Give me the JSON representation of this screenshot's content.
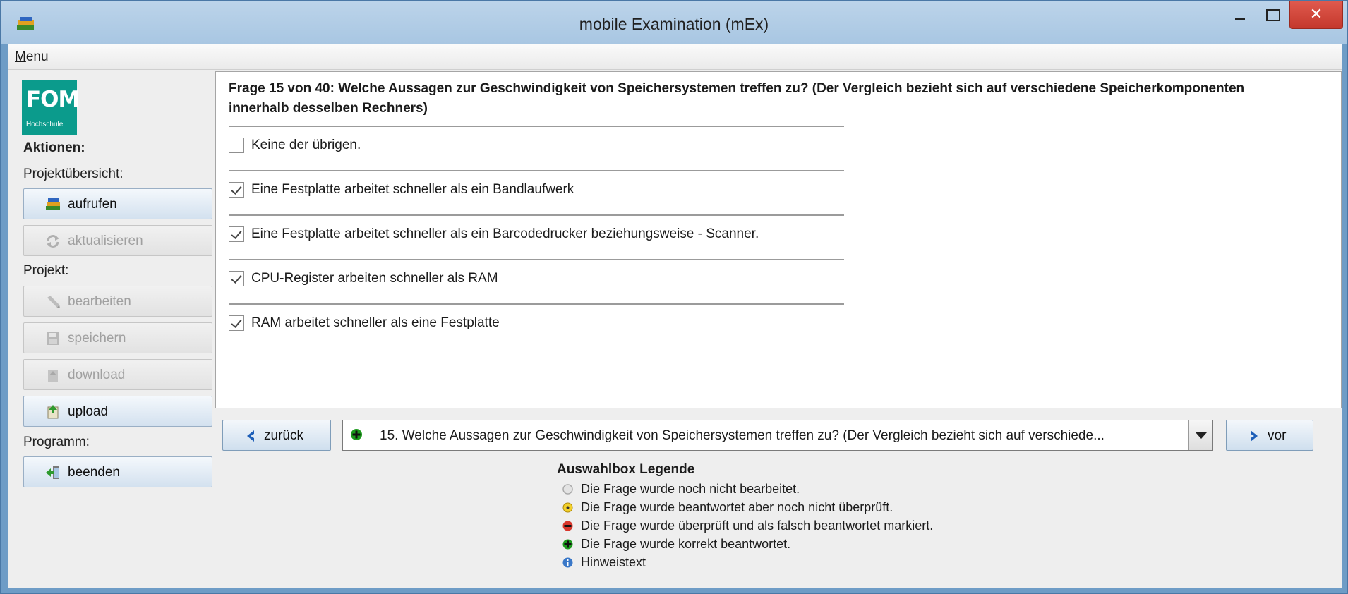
{
  "window": {
    "title": "mobile Examination (mEx)",
    "close_label": "✕"
  },
  "menu": {
    "label_mnemonic": "M",
    "label_rest": "enu"
  },
  "logo": {
    "main": "FOM",
    "sub": "Hochschule"
  },
  "sidebar": {
    "actions_heading": "Aktionen:",
    "overview_label": "Projektübersicht:",
    "btn_open": "aufrufen",
    "btn_refresh": "aktualisieren",
    "project_label": "Projekt:",
    "btn_edit": "bearbeiten",
    "btn_save": "speichern",
    "btn_download": "download",
    "btn_upload": "upload",
    "program_label": "Programm:",
    "btn_exit": "beenden"
  },
  "question": {
    "title": "Frage 15 von 40: Welche Aussagen zur Geschwindigkeit von Speichersystemen treffen zu? (Der Vergleich bezieht sich auf verschiedene Speicherkomponenten innerhalb desselben Rechners)",
    "options": [
      {
        "text": "Keine der übrigen.",
        "checked": false
      },
      {
        "text": "Eine Festplatte arbeitet schneller als ein Bandlaufwerk",
        "checked": true
      },
      {
        "text": "Eine Festplatte arbeitet schneller als ein Barcodedrucker beziehungsweise - Scanner.",
        "checked": true
      },
      {
        "text": "CPU-Register arbeiten schneller als RAM",
        "checked": true
      },
      {
        "text": "RAM arbeitet schneller als eine Festplatte",
        "checked": true
      }
    ]
  },
  "nav": {
    "back": "zurück",
    "forward": "vor",
    "selected_question": "15. Welche Aussagen zur Geschwindigkeit von Speichersystemen treffen zu? (Der Vergleich bezieht sich auf verschiede...",
    "selected_status": "korrekt"
  },
  "legend": {
    "title": "Auswahlbox Legende",
    "items": [
      {
        "text": "Die Frage wurde noch nicht bearbeitet.",
        "color": "#a9a9a9"
      },
      {
        "text": "Die Frage wurde beantwortet aber noch nicht überprüft.",
        "color": "#e8c21a"
      },
      {
        "text": "Die Frage wurde überprüft und als falsch beantwortet markiert.",
        "color": "#d8362a"
      },
      {
        "text": "Die Frage wurde korrekt beantwortet.",
        "color": "#1c9a1c"
      },
      {
        "text": "Hinweistext",
        "color": "#3a78c8"
      }
    ]
  },
  "colors": {
    "titlebar": "#bcd4ea",
    "window_frame": "#6e9cc6",
    "close": "#c4382c",
    "logo": "#0b9b8c"
  }
}
